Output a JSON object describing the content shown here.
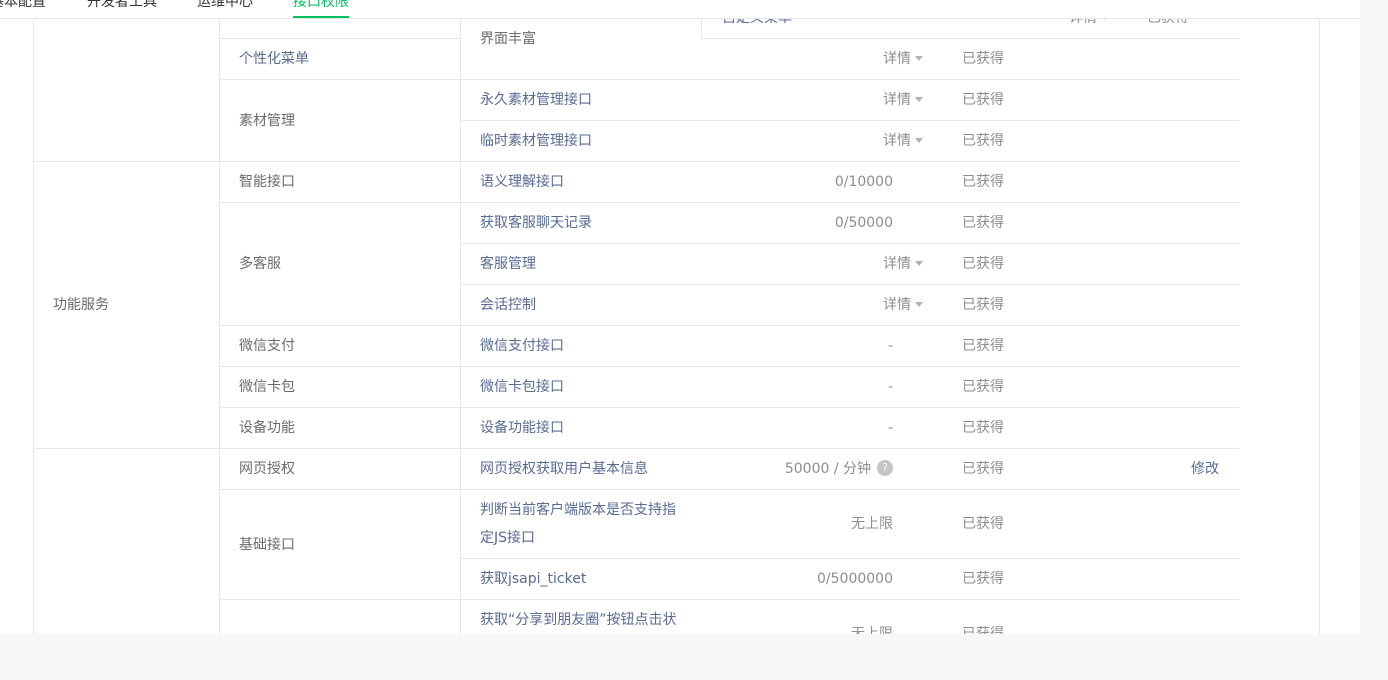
{
  "nav": {
    "tabs": [
      {
        "label": "基本配置",
        "active": false
      },
      {
        "label": "开发者工具",
        "active": false
      },
      {
        "label": "运维中心",
        "active": false
      },
      {
        "label": "接口权限",
        "active": true
      }
    ]
  },
  "overlay": {
    "name": "自定义菜单",
    "detail": "详情",
    "status": "已获得"
  },
  "categories": {
    "function_service": "功能服务"
  },
  "rows": [
    {
      "sub": "",
      "name": "界面丰富",
      "quota": "",
      "detail": "",
      "status": ""
    },
    {
      "sub": "个性化菜单",
      "name": "",
      "quota": "",
      "detail": "详情",
      "status": "已获得"
    },
    {
      "sub": "素材管理",
      "name": "永久素材管理接口",
      "quota": "",
      "detail": "详情",
      "status": "已获得"
    },
    {
      "sub": "",
      "name": "临时素材管理接口",
      "quota": "",
      "detail": "详情",
      "status": "已获得"
    },
    {
      "sub": "智能接口",
      "name": "语义理解接口",
      "quota": "0/10000",
      "detail": "",
      "status": "已获得"
    },
    {
      "sub": "多客服",
      "name": "获取客服聊天记录",
      "quota": "0/50000",
      "detail": "",
      "status": "已获得"
    },
    {
      "sub": "",
      "name": "客服管理",
      "quota": "",
      "detail": "详情",
      "status": "已获得"
    },
    {
      "sub": "",
      "name": "会话控制",
      "quota": "",
      "detail": "详情",
      "status": "已获得"
    },
    {
      "sub": "微信支付",
      "name": "微信支付接口",
      "quota": "-",
      "detail": "",
      "status": "已获得"
    },
    {
      "sub": "微信卡包",
      "name": "微信卡包接口",
      "quota": "-",
      "detail": "",
      "status": "已获得"
    },
    {
      "sub": "设备功能",
      "name": "设备功能接口",
      "quota": "-",
      "detail": "",
      "status": "已获得"
    },
    {
      "sub": "网页授权",
      "name": "网页授权获取用户基本信息",
      "quota": "50000 / 分钟",
      "detail": "",
      "status": "已获得",
      "action": "修改"
    },
    {
      "sub": "基础接口",
      "name_line1": "判断当前客户端版本是否支持指",
      "name_line2": "定JS接口",
      "quota": "无上限",
      "detail": "",
      "status": "已获得"
    },
    {
      "sub": "",
      "name": "获取jsapi_ticket",
      "quota": "0/5000000",
      "detail": "",
      "status": "已获得"
    },
    {
      "sub": "",
      "name": "获取“分享到朋友圈”按钮点击状",
      "quota": "无上限",
      "detail": "",
      "status": "已获得"
    }
  ],
  "icons": {
    "help": "?"
  }
}
